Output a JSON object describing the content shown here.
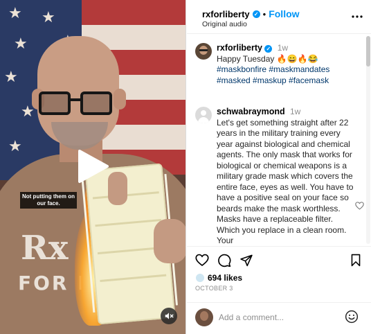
{
  "header": {
    "username": "rxforliberty",
    "separator": "•",
    "follow_label": "Follow",
    "audio": "Original audio",
    "more_icon": "more-horizontal-icon"
  },
  "video": {
    "caption_overlay": "Not putting them on our face.",
    "shirt_text_line1": "Rx",
    "shirt_text_line2": "FOR L",
    "play_icon": "play-icon",
    "mute_icon": "volume-muted-icon"
  },
  "post": {
    "username": "rxforliberty",
    "time": "1w",
    "text": "Happy Tuesday 🔥😄🔥😂",
    "hashtags": "#maskbonfire #maskmandates #masked #maskup #facemask"
  },
  "comments": [
    {
      "username": "schwabraymond",
      "time": "1w",
      "text": "Let's get something straight after 22 years in the military training every year against biological and chemical agents. The only mask that works for biological or chemical weapons is a military grade mask which covers the entire face, eyes as well. You have to have a positive seal on your face so beards make the mask worthless. Masks have a replaceable filter. Which you replace in a clean room. Your"
    }
  ],
  "actions": {
    "like_icon": "heart-icon",
    "comment_icon": "comment-icon",
    "share_icon": "send-icon",
    "save_icon": "bookmark-icon",
    "likes": "694 likes",
    "date": "OCTOBER 3"
  },
  "add_comment": {
    "placeholder": "Add a comment...",
    "emoji_icon": "smiley-icon"
  },
  "colors": {
    "accent": "#0095f6",
    "hashtag": "#00376b",
    "muted": "#8e8e8e"
  }
}
